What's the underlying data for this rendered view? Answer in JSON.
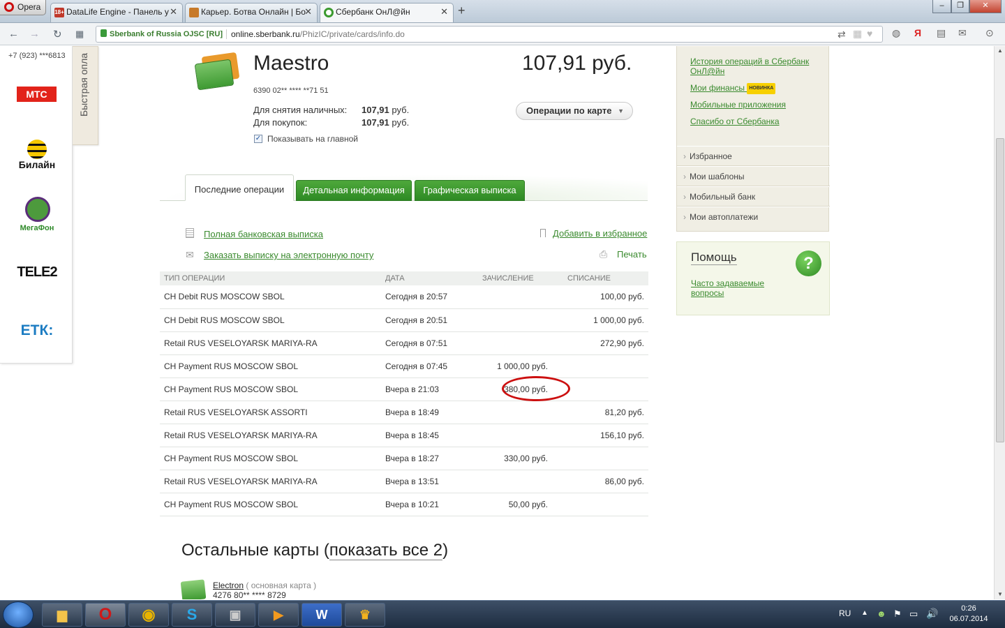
{
  "browser": {
    "menu_label": "Opera",
    "tabs": [
      {
        "title": "DataLife Engine - Панель у",
        "favicon": "18+"
      },
      {
        "title": "Карьер. Ботва Онлайн | Бо",
        "favicon": "game-icon"
      },
      {
        "title": "Сбербанк ОнЛ@йн",
        "favicon": "sberbank-icon"
      }
    ],
    "new_tab": "+",
    "security_label": "Sberbank of Russia OJSC [RU]",
    "url_host": "online.sberbank.ru",
    "url_path": "/PhizIC/private/cards/info.do"
  },
  "quick_pay": {
    "title": "Быстрая опла",
    "phone": "+7 (923) ***6813",
    "operators": [
      "МТС",
      "Билайн",
      "МегаФон",
      "TELE2",
      "ЕТК:"
    ]
  },
  "card": {
    "name": "Maestro",
    "number": "6390 02** **** **71 51",
    "balance": "107,91 руб.",
    "cash_label": "Для снятия наличных:",
    "cash_value": "107,91",
    "purchase_label": "Для покупок:",
    "purchase_value": "107,91",
    "currency": "руб.",
    "show_on_main_label": "Показывать на главной",
    "show_on_main_checked": true,
    "operations_button": "Операции по карте"
  },
  "tabs": [
    "Последние операции",
    "Детальная информация",
    "Графическая выписка"
  ],
  "actions": {
    "full_statement": "Полная банковская выписка",
    "email_statement": "Заказать выписку на электронную почту",
    "add_favorite": "Добавить в избранное",
    "print": "Печать"
  },
  "table": {
    "headers": [
      "ТИП ОПЕРАЦИИ",
      "ДАТА",
      "ЗАЧИСЛЕНИЕ",
      "СПИСАНИЕ"
    ],
    "rows": [
      {
        "type": "CH Debit RUS MOSCOW SBOL",
        "date": "Сегодня в 20:57",
        "credit": "",
        "debit": "100,00 руб."
      },
      {
        "type": "CH Debit RUS MOSCOW SBOL",
        "date": "Сегодня в 20:51",
        "credit": "",
        "debit": "1 000,00 руб."
      },
      {
        "type": "Retail RUS VESELOYARSK MARIYA-RA",
        "date": "Сегодня в 07:51",
        "credit": "",
        "debit": "272,90 руб."
      },
      {
        "type": "CH Payment RUS MOSCOW SBOL",
        "date": "Сегодня в 07:45",
        "credit": "1 000,00 руб.",
        "debit": ""
      },
      {
        "type": "CH Payment RUS MOSCOW SBOL",
        "date": "Вчера в 21:03",
        "credit": "380,00 руб.",
        "debit": ""
      },
      {
        "type": "Retail RUS VESELOYARSK ASSORTI",
        "date": "Вчера в 18:49",
        "credit": "",
        "debit": "81,20 руб."
      },
      {
        "type": "Retail RUS VESELOYARSK MARIYA-RA",
        "date": "Вчера в 18:45",
        "credit": "",
        "debit": "156,10 руб."
      },
      {
        "type": "CH Payment RUS MOSCOW SBOL",
        "date": "Вчера в 18:27",
        "credit": "330,00 руб.",
        "debit": ""
      },
      {
        "type": "Retail RUS VESELOYARSK MARIYA-RA",
        "date": "Вчера в 13:51",
        "credit": "",
        "debit": "86,00 руб."
      },
      {
        "type": "CH Payment RUS MOSCOW SBOL",
        "date": "Вчера в 10:21",
        "credit": "50,00 руб.",
        "debit": ""
      }
    ]
  },
  "other_cards": {
    "heading_prefix": "Остальные карты (",
    "show_all": "показать все 2",
    "heading_suffix": ")",
    "card_name": "Electron",
    "card_note": "( основная карта )",
    "card_number": "4276 80** **** 8729"
  },
  "sidebar": {
    "links": [
      "История операций в Сбербанк ОнЛ@йн",
      "Мои финансы",
      "Мобильные приложения",
      "Спасибо от Сбербанка"
    ],
    "new_badge": "НОВИНКА",
    "menu": [
      "Избранное",
      "Мои шаблоны",
      "Мобильный банк",
      "Мои автоплатежи"
    ],
    "help_title": "Помощь",
    "help_link": "Часто задаваемые вопросы"
  },
  "taskbar": {
    "lang": "RU",
    "time": "0:26",
    "date": "06.07.2014"
  },
  "colors": {
    "accent": "#2e8a24",
    "link": "#3a8a2e",
    "highlight_circle": "#cc1010"
  }
}
